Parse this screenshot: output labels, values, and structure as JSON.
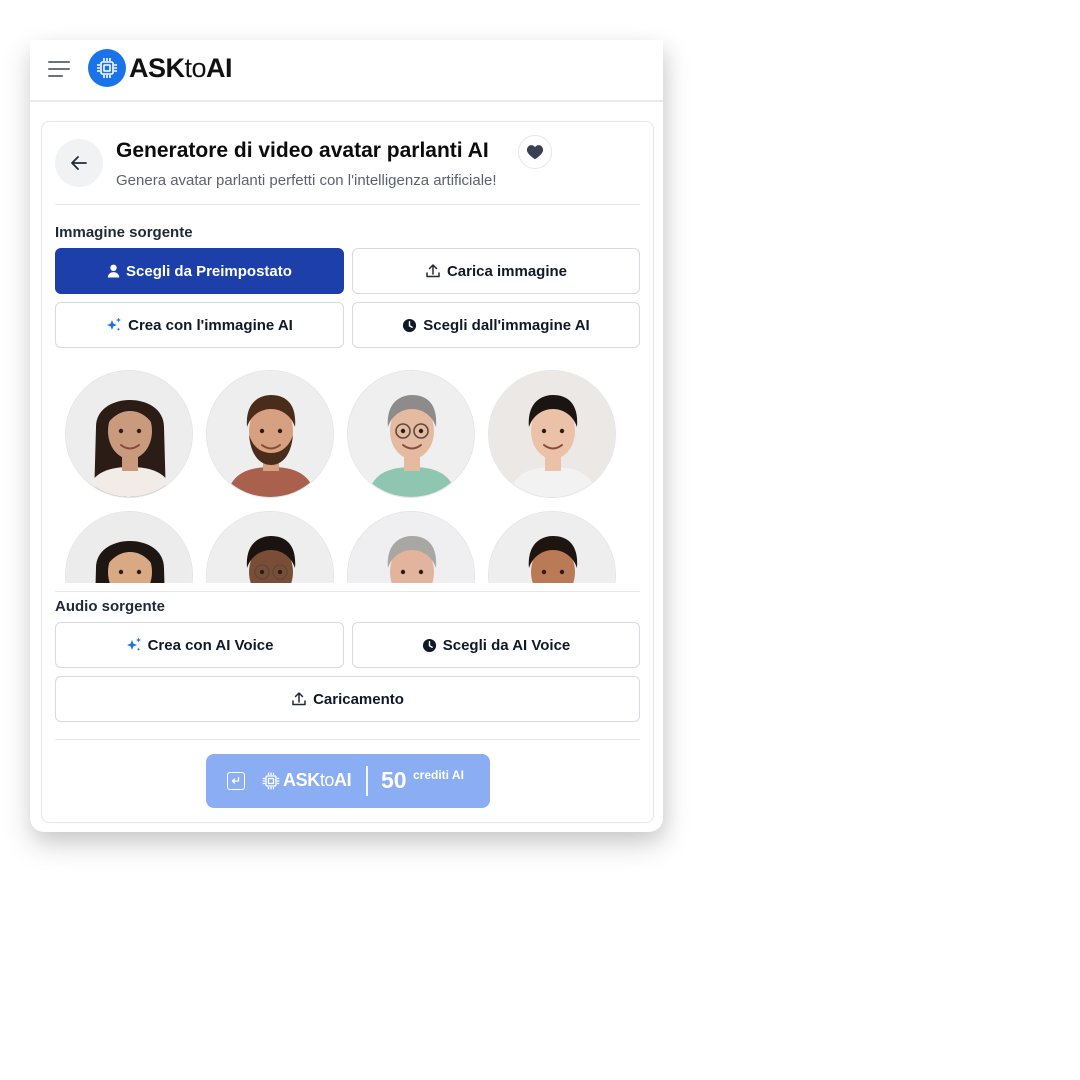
{
  "brand": {
    "name_part1": "ASK",
    "name_part2": "to",
    "name_part3": "AI",
    "color": "#1a73e8"
  },
  "header": {
    "title": "Generatore di video avatar parlanti AI",
    "subtitle": "Genera avatar parlanti perfetti con l'intelligenza artificiale!"
  },
  "image_source": {
    "label": "Immagine sorgente",
    "options": [
      {
        "label": "Scegli da Preimpostato",
        "icon": "user-icon",
        "selected": true
      },
      {
        "label": "Carica immagine",
        "icon": "upload-icon",
        "selected": false
      },
      {
        "label": "Crea con l'immagine AI",
        "icon": "sparkle-icon",
        "selected": false
      },
      {
        "label": "Scegli dall'immagine AI",
        "icon": "clock-icon",
        "selected": false
      }
    ]
  },
  "avatars": [
    {
      "description": "woman long dark hair",
      "skin": "#c99a7e",
      "hair": "#2b1d16",
      "shirt": "#f1ece6",
      "bg": "#ededee"
    },
    {
      "description": "man brown hair beard",
      "skin": "#d7a080",
      "hair": "#4a2c1a",
      "shirt": "#a9604c",
      "bg": "#eeeeee"
    },
    {
      "description": "older woman grey hair glasses",
      "skin": "#e4bba1",
      "hair": "#8d8c8a",
      "shirt": "#8fc6b1",
      "bg": "#efefef"
    },
    {
      "description": "woman black bob",
      "skin": "#ebc2a7",
      "hair": "#1a1412",
      "shirt": "#f2f2f2",
      "bg": "#ebe8e6"
    },
    {
      "description": "woman long dark hair",
      "skin": "#d8a983",
      "hair": "#1e1612",
      "shirt": "#f4f0ea",
      "bg": "#ececec"
    },
    {
      "description": "man curly hair glasses",
      "skin": "#7a4e36",
      "hair": "#1b130f",
      "shirt": "#d8d4cf",
      "bg": "#eeeeee"
    },
    {
      "description": "older man grey hair",
      "skin": "#e2b49d",
      "hair": "#a9a7a4",
      "shirt": "#d8d8d8",
      "bg": "#efeff1"
    },
    {
      "description": "man short dark hair",
      "skin": "#b97a55",
      "hair": "#1e1410",
      "shirt": "#3e3e3e",
      "bg": "#eeeeee"
    }
  ],
  "audio_source": {
    "label": "Audio sorgente",
    "options": [
      {
        "label": "Crea con AI Voice",
        "icon": "sparkle-icon"
      },
      {
        "label": "Scegli da AI Voice",
        "icon": "clock-icon"
      },
      {
        "label": "Caricamento",
        "icon": "upload-icon"
      }
    ]
  },
  "generate": {
    "amount": "50",
    "unit": "crediti AI",
    "color": "#8aadf3"
  },
  "colors": {
    "primary": "#1c3faa",
    "sparkle": "#1a73e8"
  }
}
